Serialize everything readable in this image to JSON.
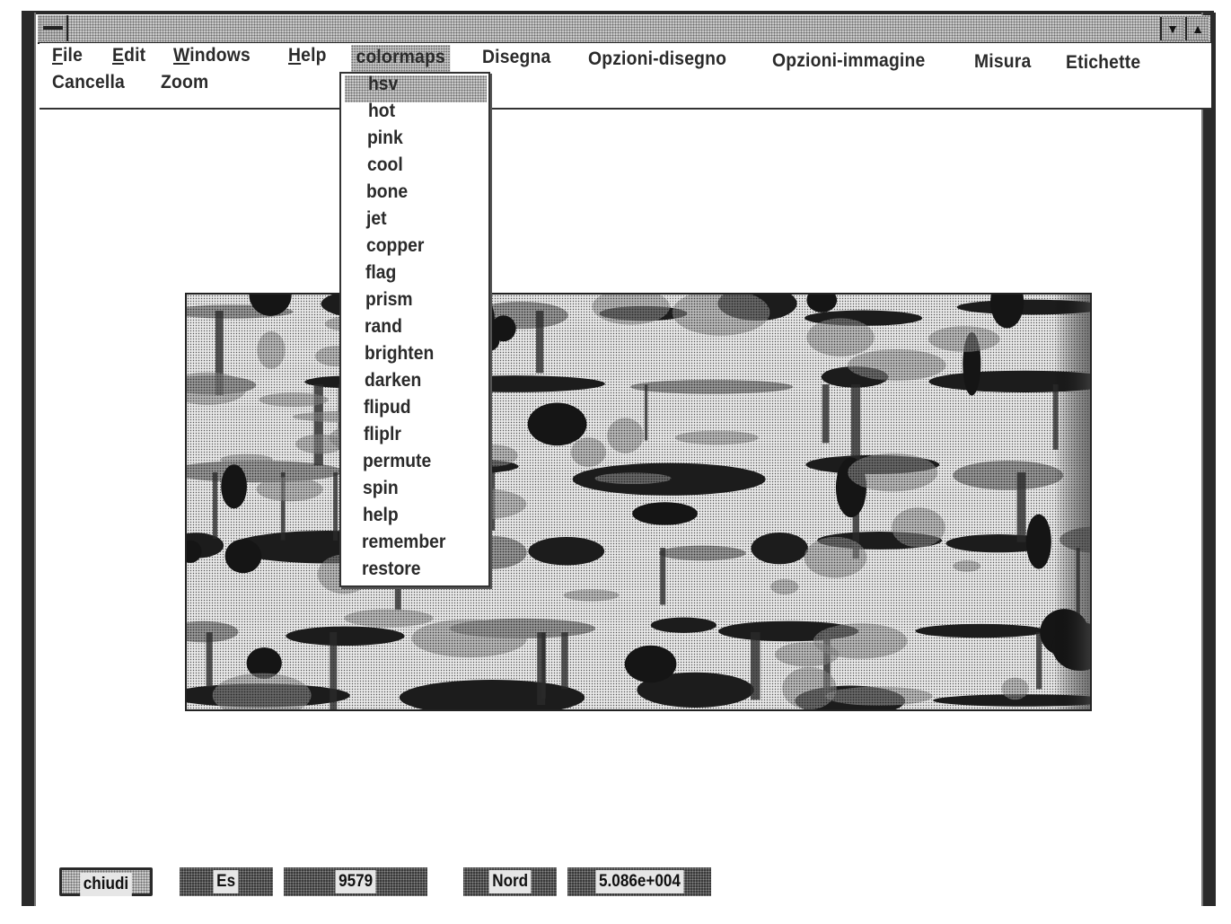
{
  "window": {
    "title": "",
    "minimize_glyph": "▼",
    "maximize_glyph": "▲"
  },
  "menubar": {
    "row1": [
      {
        "label": "File",
        "mnemonic": "F",
        "rest": "ile"
      },
      {
        "label": "Edit",
        "mnemonic": "E",
        "rest": "dit"
      },
      {
        "label": "Windows",
        "mnemonic": "W",
        "rest": "indows"
      },
      {
        "label": "Help",
        "mnemonic": "H",
        "rest": "elp"
      },
      {
        "label": "colormaps"
      },
      {
        "label": "Disegna"
      },
      {
        "label": "Opzioni-disegno"
      },
      {
        "label": "Opzioni-immagine"
      },
      {
        "label": "Misura"
      },
      {
        "label": "Etichette"
      }
    ],
    "row2": [
      {
        "label": "Cancella"
      },
      {
        "label": "Zoom"
      }
    ],
    "active_menu": "colormaps"
  },
  "colormaps_menu": {
    "highlighted": "hsv",
    "items": [
      "hsv",
      "hot",
      "pink",
      "cool",
      "bone",
      "jet",
      "copper",
      "flag",
      "prism",
      "rand",
      "brighten",
      "darken",
      "flipud",
      "fliplr",
      "permute",
      "spin",
      "help",
      "remember",
      "restore"
    ]
  },
  "figure": {
    "content": "grayscale stone wall image"
  },
  "controls": {
    "close_button": "chiudi",
    "east_label": "Es",
    "east_value": "9579",
    "north_label": "Nord",
    "north_value": "5.086e+004"
  }
}
